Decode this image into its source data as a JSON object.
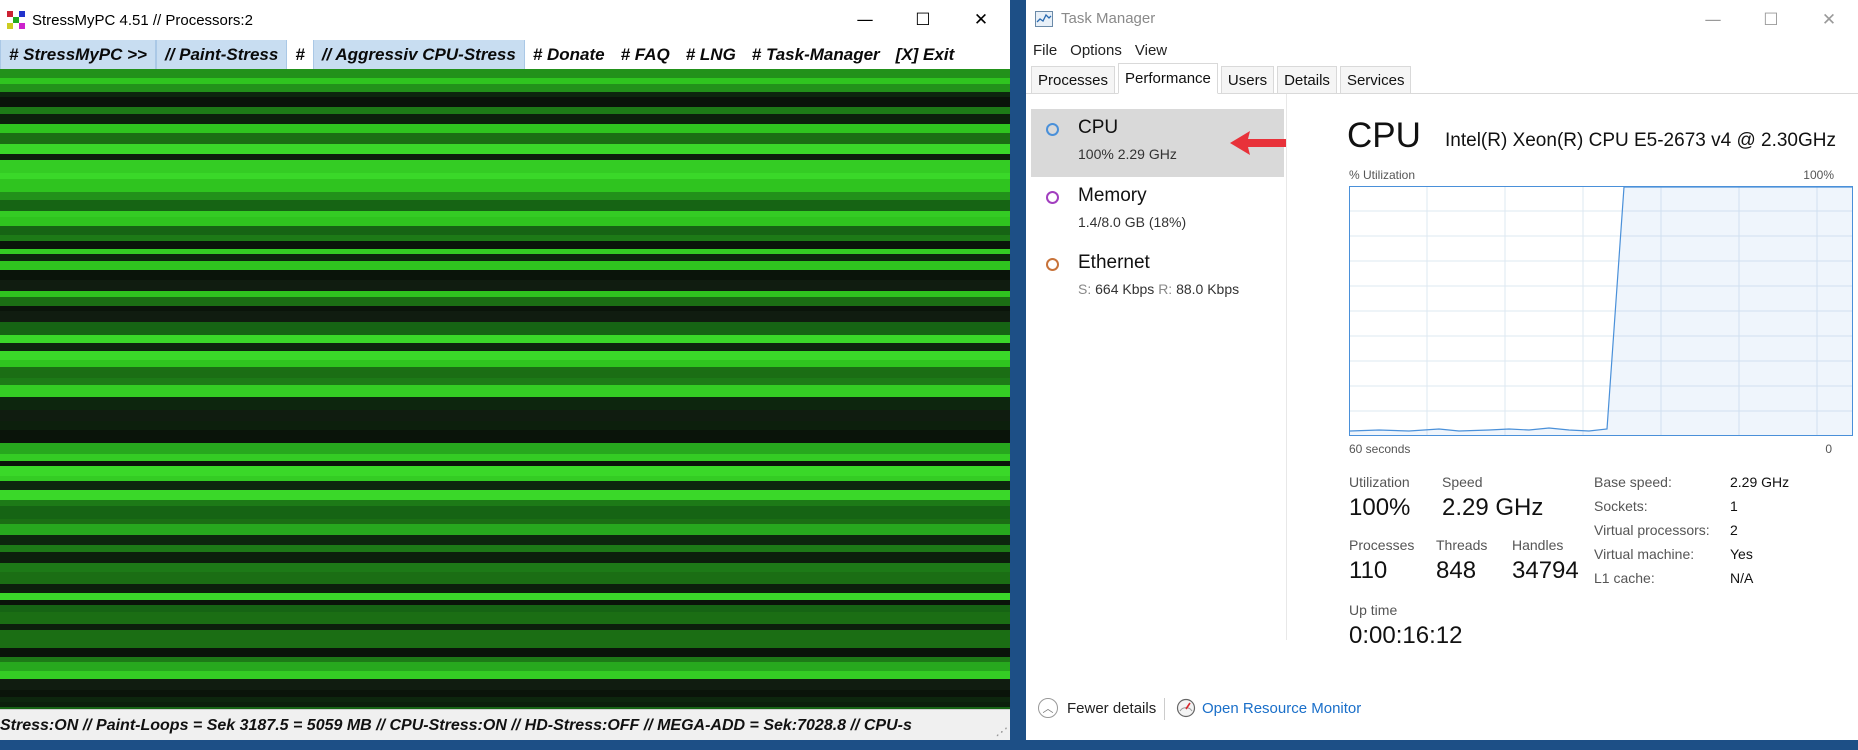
{
  "stress_window": {
    "title": "StressMyPC 4.51 // Processors:2",
    "controls": {
      "minimize": "—",
      "maximize": "☐",
      "close": "✕"
    },
    "menu": [
      {
        "label": "# StressMyPC >>",
        "highlighted": true
      },
      {
        "label": "// Paint-Stress",
        "highlighted": true
      },
      {
        "label": "#",
        "highlighted": false
      },
      {
        "label": "// Aggressiv CPU-Stress",
        "highlighted": true
      },
      {
        "label": "# Donate",
        "highlighted": false
      },
      {
        "label": "# FAQ",
        "highlighted": false
      },
      {
        "label": "# LNG",
        "highlighted": false
      },
      {
        "label": "# Task-Manager",
        "highlighted": false
      },
      {
        "label": "[X] Exit",
        "highlighted": false
      }
    ],
    "status_line": "Stress:ON // Paint-Loops = Sek 3187.5 = 5059 MB // CPU-Stress:ON // HD-Stress:OFF // MEGA-ADD = Sek:7028.8 // CPU-s"
  },
  "task_manager": {
    "title": "Task Manager",
    "controls": {
      "minimize": "—",
      "maximize": "☐",
      "close": "✕"
    },
    "menu": [
      "File",
      "Options",
      "View"
    ],
    "tabs": [
      {
        "label": "Processes",
        "active": false
      },
      {
        "label": "Performance",
        "active": true
      },
      {
        "label": "Users",
        "active": false
      },
      {
        "label": "Details",
        "active": false
      },
      {
        "label": "Services",
        "active": false
      }
    ],
    "resources": [
      {
        "name": "CPU",
        "sub": "100%  2.29 GHz",
        "color": "#4a90d9",
        "selected": true
      },
      {
        "name": "Memory",
        "sub": "1.4/8.0 GB (18%)",
        "color": "#a23fbf",
        "selected": false
      },
      {
        "name": "Ethernet",
        "sub_s_label": "S:",
        "sub_s": "664 Kbps",
        "sub_r_label": "R:",
        "sub_r": "88.0 Kbps",
        "color": "#c8733a",
        "selected": false
      }
    ],
    "cpu": {
      "heading": "CPU",
      "model": "Intel(R) Xeon(R) CPU E5-2673 v4 @ 2.30GHz",
      "util_label": "% Utilization",
      "util_max": "100%",
      "x_left": "60 seconds",
      "x_right": "0",
      "graph_line_color": "#4a90d9",
      "stats": {
        "utilization_label": "Utilization",
        "utilization": "100%",
        "speed_label": "Speed",
        "speed": "2.29 GHz",
        "processes_label": "Processes",
        "processes": "110",
        "threads_label": "Threads",
        "threads": "848",
        "handles_label": "Handles",
        "handles": "34794",
        "uptime_label": "Up time",
        "uptime": "0:00:16:12"
      },
      "details": [
        {
          "label": "Base speed:",
          "value": "2.29 GHz"
        },
        {
          "label": "Sockets:",
          "value": "1"
        },
        {
          "label": "Virtual processors:",
          "value": "2"
        },
        {
          "label": "Virtual machine:",
          "value": "Yes"
        },
        {
          "label": "L1 cache:",
          "value": "N/A"
        }
      ]
    },
    "footer": {
      "fewer": "Fewer details",
      "resource_monitor": "Open Resource Monitor"
    }
  }
}
